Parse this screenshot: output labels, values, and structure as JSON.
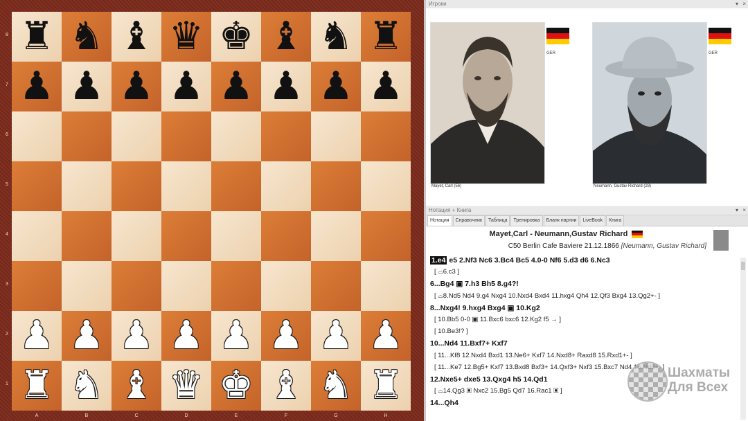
{
  "board": {
    "ranks": [
      "8",
      "7",
      "6",
      "5",
      "4",
      "3",
      "2",
      "1"
    ],
    "files": [
      "A",
      "B",
      "C",
      "D",
      "E",
      "F",
      "G",
      "H"
    ],
    "rows": [
      [
        "r",
        "n",
        "b",
        "q",
        "k",
        "b",
        "n",
        "r"
      ],
      [
        "p",
        "p",
        "p",
        "p",
        "p",
        "p",
        "p",
        "p"
      ],
      [
        "",
        "",
        "",
        "",
        "",
        "",
        "",
        ""
      ],
      [
        "",
        "",
        "",
        "",
        "",
        "",
        "",
        ""
      ],
      [
        "",
        "",
        "",
        "",
        "",
        "",
        "",
        ""
      ],
      [
        "",
        "",
        "",
        "",
        "",
        "",
        "",
        ""
      ],
      [
        "P",
        "P",
        "P",
        "P",
        "P",
        "P",
        "P",
        "P"
      ],
      [
        "R",
        "N",
        "B",
        "Q",
        "K",
        "B",
        "N",
        "R"
      ]
    ],
    "colors": {
      "light": "#f2dcc0",
      "dark": "#d2722e",
      "frame": "#7a2a1a"
    }
  },
  "players_panel": {
    "title": "Игроки",
    "white": {
      "country": "GER",
      "caption": "Mayet, Carl (56)"
    },
    "black": {
      "country": "GER",
      "caption": "Neumann, Gustav Richard (28)"
    }
  },
  "notation_panel": {
    "title": "Нотация + Книга",
    "tabs": [
      "Нотация",
      "Справочник",
      "Таблица",
      "Тренировка",
      "Бланк партии",
      "LiveBook",
      "Книга"
    ],
    "active_tab": 0,
    "header_line1": "Mayet,Carl - Neumann,Gustav Richard",
    "header_line2_main": "C50 Berlin Cafe Baviere 21.12.1866",
    "header_line2_annotator": "[Neumann, Gustav Richard]",
    "lines": [
      {
        "kind": "main",
        "text": "1.e4 e5 2.Nf3 Nc6 3.Bc4 Bc5 4.0-0 Nf6 5.d3 d6 6.Nc3",
        "highlight": "1.e4"
      },
      {
        "kind": "var",
        "text": "[ ⌓6.c3 ]"
      },
      {
        "kind": "main",
        "text": "6...Bg4 ▣ 7.h3 Bh5 8.g4?!"
      },
      {
        "kind": "var",
        "text": "[ ⌓8.Nd5 Nd4 9.g4 Nxg4 10.Nxd4 Bxd4 11.hxg4 Qh4 12.Qf3 Bxg4 13.Qg2+- ]"
      },
      {
        "kind": "main",
        "text": "8...Nxg4! 9.hxg4 Bxg4 ▣ 10.Kg2"
      },
      {
        "kind": "var",
        "text": "[ 10.Bb5 0-0 ▣ 11.Bxc6 bxc6 12.Kg2 f5 → ]"
      },
      {
        "kind": "var",
        "text": "[ 10.Be3!? ]"
      },
      {
        "kind": "main",
        "text": "10...Nd4 11.Bxf7+ Kxf7"
      },
      {
        "kind": "var",
        "text": "[ 11...Kf8 12.Nxd4 Bxd1 13.Ne6+ Kxf7 14.Nxd8+ Raxd8 15.Rxd1+- ]"
      },
      {
        "kind": "var",
        "text": "[ 11...Ke7 12.Bg5+ Kxf7 13.Bxd8 Bxf3+ 14.Qxf3+ Nxf3 15.Bxc7 Nd4 16.Nd5+- ]"
      },
      {
        "kind": "main",
        "text": "12.Nxe5+ dxe5 13.Qxg4 h5 14.Qd1"
      },
      {
        "kind": "var",
        "text": "[ ⌓14.Qg3 ▣ Nxc2 15.Bg5 Qd7 16.Rac1 ▣ ]"
      },
      {
        "kind": "main",
        "text": "14...Qh4"
      }
    ]
  },
  "logo": {
    "line1": "Шахматы",
    "line2": "Для Всех"
  },
  "flag_colors": [
    "#111111",
    "#dd1111",
    "#ffcc00"
  ]
}
